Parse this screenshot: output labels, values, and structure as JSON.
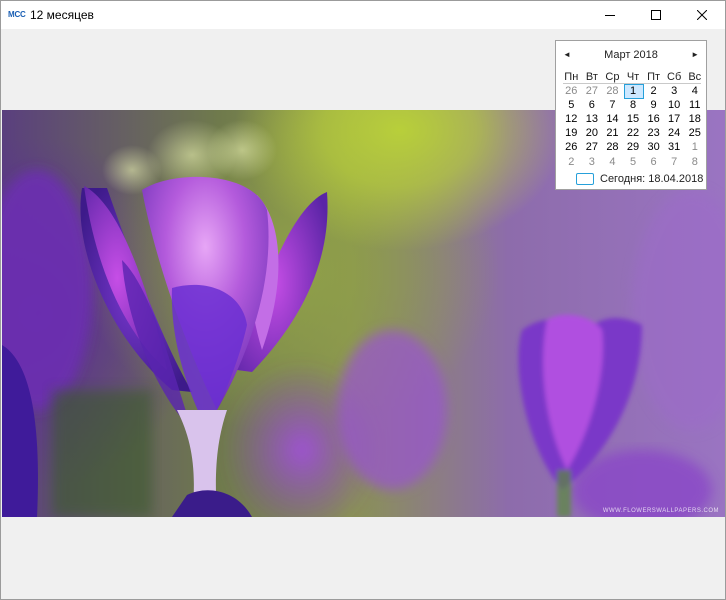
{
  "window": {
    "icon_text": "MCC",
    "title": "12 месяцев"
  },
  "calendar": {
    "month_label": "Март 2018",
    "weekdays": [
      "Пн",
      "Вт",
      "Ср",
      "Чт",
      "Пт",
      "Сб",
      "Вс"
    ],
    "weeks": [
      [
        "26",
        "27",
        "28",
        "1",
        "2",
        "3",
        "4"
      ],
      [
        "5",
        "6",
        "7",
        "8",
        "9",
        "10",
        "11"
      ],
      [
        "12",
        "13",
        "14",
        "15",
        "16",
        "17",
        "18"
      ],
      [
        "19",
        "20",
        "21",
        "22",
        "23",
        "24",
        "25"
      ],
      [
        "26",
        "27",
        "28",
        "29",
        "30",
        "31",
        "1"
      ],
      [
        "2",
        "3",
        "4",
        "5",
        "6",
        "7",
        "8"
      ]
    ],
    "selected_day": "1",
    "today_label": "Сегодня: 18.04.2018",
    "accent_color": "#26a0da"
  },
  "photo": {
    "watermark": "WWW.FLOWERSWALLPAPERS.COM"
  }
}
